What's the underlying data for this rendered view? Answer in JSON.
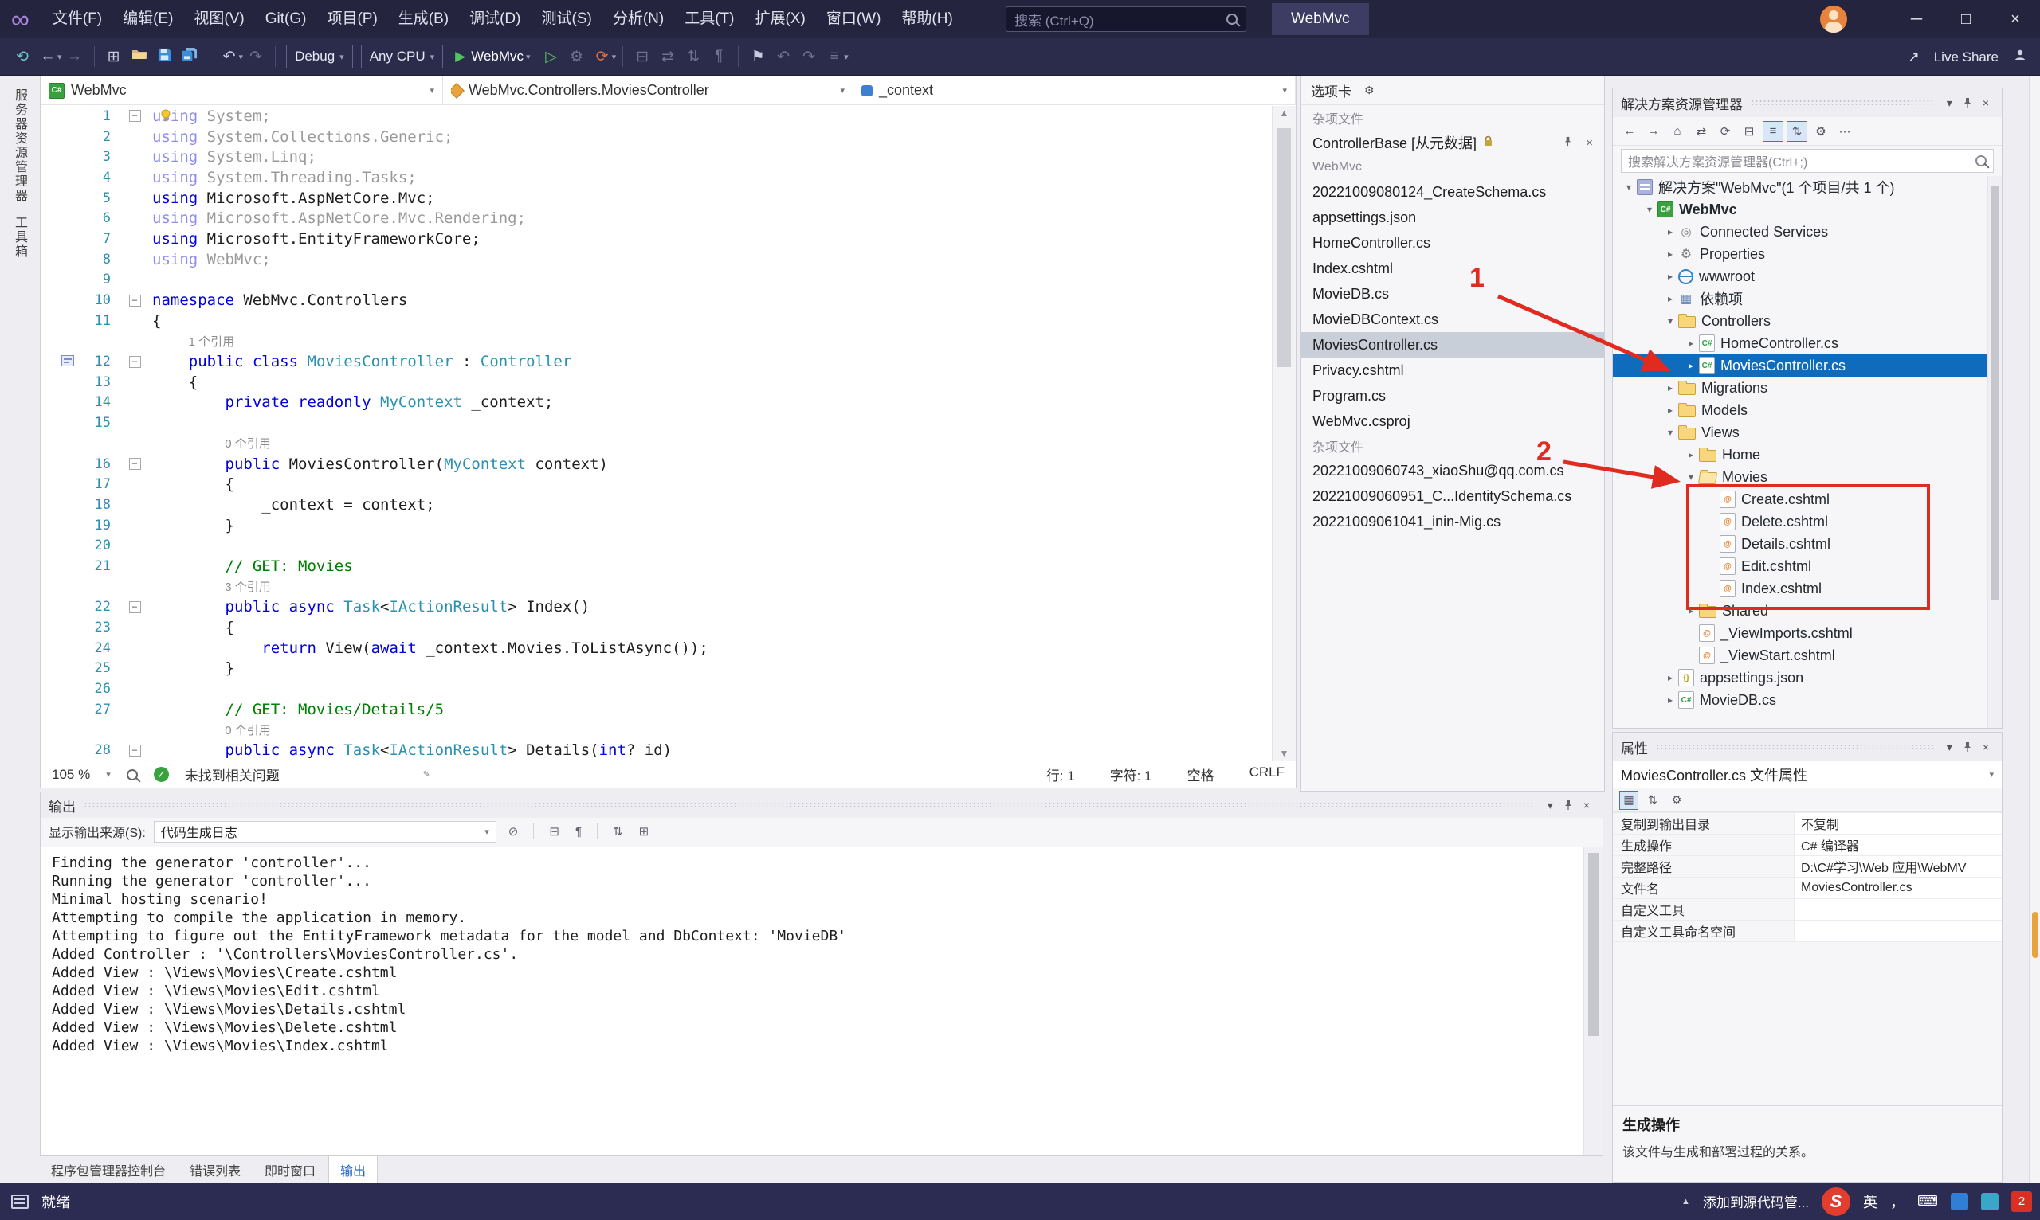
{
  "icons": {
    "minimize": "─",
    "maximize": "□",
    "close": "×",
    "caret": "▾",
    "chevron": "▸",
    "back": "←",
    "forward": "→",
    "nav-circle": "⟲",
    "undo": "↶",
    "redo": "↷",
    "refresh": "⟳",
    "play": "▶",
    "play-outline": "▷",
    "home": "⌂",
    "collapse": "⊟",
    "expand": "⊞",
    "menu": "≡",
    "swap": "⇄",
    "sort": "⇅",
    "bookmark": "⚑",
    "more": "⋯",
    "gear": "⚙",
    "check": "✓",
    "up": "▲",
    "down": "▼",
    "keyboard": "⌨",
    "pencil": "✎",
    "clear": "⊘",
    "wrap": "¶",
    "share": "↗",
    "infinity": "∞",
    "comma": "，",
    "grid": "▦"
  },
  "window": {
    "title": "WebMvc",
    "search_placeholder": "搜索 (Ctrl+Q)"
  },
  "menus": [
    "文件(F)",
    "编辑(E)",
    "视图(V)",
    "Git(G)",
    "项目(P)",
    "生成(B)",
    "调试(D)",
    "测试(S)",
    "分析(N)",
    "工具(T)",
    "扩展(X)",
    "窗口(W)",
    "帮助(H)"
  ],
  "toolbar": {
    "debug": "Debug",
    "platform": "Any CPU",
    "run_target": "WebMvc",
    "live_share": "Live Share"
  },
  "left_tabs": [
    "服务器资源管理器",
    "工具箱"
  ],
  "breadcrumb": {
    "project": "WebMvc",
    "type": "WebMvc.Controllers.MoviesController",
    "member": "_context"
  },
  "editor": {
    "zoom": "105 %",
    "problems": "未找到相关问题",
    "line": "行: 1",
    "col": "字符: 1",
    "space": "空格",
    "eol": "CRLF",
    "rows": [
      {
        "n": "1",
        "fold": true,
        "f": true,
        "s": [
          [
            "kw",
            "using"
          ],
          [
            "pl",
            " System;"
          ]
        ]
      },
      {
        "n": "2",
        "f": true,
        "s": [
          [
            "kw",
            "using"
          ],
          [
            "pl",
            " System.Collections.Generic;"
          ]
        ]
      },
      {
        "n": "3",
        "f": true,
        "s": [
          [
            "kw",
            "using"
          ],
          [
            "pl",
            " System.Linq;"
          ]
        ]
      },
      {
        "n": "4",
        "f": true,
        "s": [
          [
            "kw",
            "using"
          ],
          [
            "pl",
            " System.Threading.Tasks;"
          ]
        ]
      },
      {
        "n": "5",
        "s": [
          [
            "kw",
            "using"
          ],
          [
            "pl",
            " Microsoft.AspNetCore.Mvc;"
          ]
        ]
      },
      {
        "n": "6",
        "f": true,
        "s": [
          [
            "kw",
            "using"
          ],
          [
            "pl",
            " Microsoft.AspNetCore.Mvc.Rendering;"
          ]
        ]
      },
      {
        "n": "7",
        "s": [
          [
            "kw",
            "using"
          ],
          [
            "pl",
            " Microsoft.EntityFrameworkCore;"
          ]
        ]
      },
      {
        "n": "8",
        "f": true,
        "s": [
          [
            "kw",
            "using"
          ],
          [
            "pl",
            " WebMvc;"
          ]
        ]
      },
      {
        "n": "9",
        "s": []
      },
      {
        "n": "10",
        "fold": true,
        "s": [
          [
            "kw",
            "namespace"
          ],
          [
            "pl",
            " WebMvc.Controllers"
          ]
        ]
      },
      {
        "n": "11",
        "s": [
          [
            "pl",
            "{"
          ]
        ]
      },
      {
        "lens": "1 个引用",
        "ind": 4
      },
      {
        "n": "12",
        "fold": true,
        "s": [
          [
            "pl",
            "    "
          ],
          [
            "kw",
            "public"
          ],
          [
            "pl",
            " "
          ],
          [
            "kw",
            "class"
          ],
          [
            "pl",
            " "
          ],
          [
            "ty",
            "MoviesController"
          ],
          [
            "pl",
            " : "
          ],
          [
            "ty",
            "Controller"
          ]
        ]
      },
      {
        "n": "13",
        "s": [
          [
            "pl",
            "    {"
          ]
        ]
      },
      {
        "n": "14",
        "s": [
          [
            "pl",
            "        "
          ],
          [
            "kw",
            "private"
          ],
          [
            "pl",
            " "
          ],
          [
            "kw",
            "readonly"
          ],
          [
            "pl",
            " "
          ],
          [
            "ty",
            "MyContext"
          ],
          [
            "pl",
            " _context;"
          ]
        ]
      },
      {
        "n": "15",
        "s": []
      },
      {
        "lens": "0 个引用",
        "ind": 8
      },
      {
        "n": "16",
        "fold": true,
        "s": [
          [
            "pl",
            "        "
          ],
          [
            "kw",
            "public"
          ],
          [
            "pl",
            " MoviesController("
          ],
          [
            "ty",
            "MyContext"
          ],
          [
            "pl",
            " context)"
          ]
        ]
      },
      {
        "n": "17",
        "s": [
          [
            "pl",
            "        {"
          ]
        ]
      },
      {
        "n": "18",
        "s": [
          [
            "pl",
            "            _context = context;"
          ]
        ]
      },
      {
        "n": "19",
        "s": [
          [
            "pl",
            "        }"
          ]
        ]
      },
      {
        "n": "20",
        "s": []
      },
      {
        "n": "21",
        "s": [
          [
            "pl",
            "        "
          ],
          [
            "cm",
            "// GET: Movies"
          ]
        ]
      },
      {
        "lens": "3 个引用",
        "ind": 8
      },
      {
        "n": "22",
        "fold": true,
        "s": [
          [
            "pl",
            "        "
          ],
          [
            "kw",
            "public"
          ],
          [
            "pl",
            " "
          ],
          [
            "kw",
            "async"
          ],
          [
            "pl",
            " "
          ],
          [
            "ty",
            "Task"
          ],
          [
            "pl",
            "<"
          ],
          [
            "ty",
            "IActionResult"
          ],
          [
            "pl",
            "> Index()"
          ]
        ]
      },
      {
        "n": "23",
        "s": [
          [
            "pl",
            "        {"
          ]
        ]
      },
      {
        "n": "24",
        "s": [
          [
            "pl",
            "            "
          ],
          [
            "kw",
            "return"
          ],
          [
            "pl",
            " View("
          ],
          [
            "kw",
            "await"
          ],
          [
            "pl",
            " _context.Movies.ToListAsync());"
          ]
        ]
      },
      {
        "n": "25",
        "s": [
          [
            "pl",
            "        }"
          ]
        ]
      },
      {
        "n": "26",
        "s": []
      },
      {
        "n": "27",
        "s": [
          [
            "pl",
            "        "
          ],
          [
            "cm",
            "// GET: Movies/Details/5"
          ]
        ]
      },
      {
        "lens": "0 个引用",
        "ind": 8
      },
      {
        "n": "28",
        "fold": true,
        "s": [
          [
            "pl",
            "        "
          ],
          [
            "kw",
            "public"
          ],
          [
            "pl",
            " "
          ],
          [
            "kw",
            "async"
          ],
          [
            "pl",
            " "
          ],
          [
            "ty",
            "Task"
          ],
          [
            "pl",
            "<"
          ],
          [
            "ty",
            "IActionResult"
          ],
          [
            "pl",
            "> Details("
          ],
          [
            "kw",
            "int"
          ],
          [
            "pl",
            "? id)"
          ]
        ]
      }
    ]
  },
  "tabs_panel": {
    "title": "选项卡",
    "sections": [
      {
        "label": "杂项文件",
        "items": [
          {
            "text": "ControllerBase [从元数据]",
            "lock": true,
            "preview": true
          }
        ]
      },
      {
        "label": "WebMvc",
        "items": [
          {
            "text": "20221009080124_CreateSchema.cs"
          },
          {
            "text": "appsettings.json"
          },
          {
            "text": "HomeController.cs"
          },
          {
            "text": "Index.cshtml"
          },
          {
            "text": "MovieDB.cs"
          },
          {
            "text": "MovieDBContext.cs"
          },
          {
            "text": "MoviesController.cs",
            "sel": true
          },
          {
            "text": "Privacy.cshtml"
          },
          {
            "text": "Program.cs"
          },
          {
            "text": "WebMvc.csproj"
          }
        ]
      },
      {
        "label": "杂项文件",
        "items": [
          {
            "text": "20221009060743_xiaoShu@qq.com.cs"
          },
          {
            "text": "20221009060951_C...IdentitySchema.cs"
          },
          {
            "text": "20221009061041_inin-Mig.cs"
          }
        ]
      }
    ]
  },
  "solution_explorer": {
    "title": "解决方案资源管理器",
    "search_placeholder": "搜索解决方案资源管理器(Ctrl+;)",
    "tree": [
      {
        "l": "解决方案\"WebMvc\"(1 个项目/共 1 个)",
        "i": 0,
        "a": "e",
        "ic": "sol"
      },
      {
        "l": "WebMvc",
        "i": 1,
        "a": "e",
        "ic": "csproj",
        "b": true
      },
      {
        "l": "Connected Services",
        "i": 2,
        "a": "c",
        "ic": "svc"
      },
      {
        "l": "Properties",
        "i": 2,
        "a": "c",
        "ic": "props"
      },
      {
        "l": "wwwroot",
        "i": 2,
        "a": "c",
        "ic": "globe"
      },
      {
        "l": "依赖项",
        "i": 2,
        "a": "c",
        "ic": "deps"
      },
      {
        "l": "Controllers",
        "i": 2,
        "a": "e",
        "ic": "folder"
      },
      {
        "l": "HomeController.cs",
        "i": 3,
        "a": "c",
        "ic": "cs"
      },
      {
        "l": "MoviesController.cs",
        "i": 3,
        "a": "c",
        "ic": "cs",
        "sel": true
      },
      {
        "l": "Migrations",
        "i": 2,
        "a": "c",
        "ic": "folder"
      },
      {
        "l": "Models",
        "i": 2,
        "a": "c",
        "ic": "folder"
      },
      {
        "l": "Views",
        "i": 2,
        "a": "e",
        "ic": "folder"
      },
      {
        "l": "Home",
        "i": 3,
        "a": "c",
        "ic": "folder"
      },
      {
        "l": "Movies",
        "i": 3,
        "a": "e",
        "ic": "folderopen"
      },
      {
        "l": "Create.cshtml",
        "i": 4,
        "ic": "razor"
      },
      {
        "l": "Delete.cshtml",
        "i": 4,
        "ic": "razor"
      },
      {
        "l": "Details.cshtml",
        "i": 4,
        "ic": "razor"
      },
      {
        "l": "Edit.cshtml",
        "i": 4,
        "ic": "razor"
      },
      {
        "l": "Index.cshtml",
        "i": 4,
        "ic": "razor"
      },
      {
        "l": "Shared",
        "i": 3,
        "a": "c",
        "ic": "folder"
      },
      {
        "l": "_ViewImports.cshtml",
        "i": 3,
        "ic": "razor"
      },
      {
        "l": "_ViewStart.cshtml",
        "i": 3,
        "ic": "razor"
      },
      {
        "l": "appsettings.json",
        "i": 2,
        "a": "c",
        "ic": "json"
      },
      {
        "l": "MovieDB.cs",
        "i": 2,
        "a": "c",
        "ic": "cs"
      }
    ]
  },
  "properties": {
    "title": "属性",
    "subtitle": "MoviesController.cs 文件属性",
    "rows": [
      [
        "复制到输出目录",
        "不复制"
      ],
      [
        "生成操作",
        "C# 编译器"
      ],
      [
        "完整路径",
        "D:\\C#学习\\Web 应用\\WebMV"
      ],
      [
        "文件名",
        "MoviesController.cs"
      ],
      [
        "自定义工具",
        ""
      ],
      [
        "自定义工具命名空间",
        ""
      ]
    ],
    "desc_title": "生成操作",
    "desc_text": "该文件与生成和部署过程的关系。"
  },
  "output": {
    "title": "输出",
    "source_label": "显示输出来源(S):",
    "source_value": "代码生成日志",
    "lines": [
      "Finding the generator 'controller'...",
      "Running the generator 'controller'...",
      "Minimal hosting scenario!",
      "Attempting to compile the application in memory.",
      "Attempting to figure out the EntityFramework metadata for the model and DbContext: 'MovieDB'",
      "Added Controller : '\\Controllers\\MoviesController.cs'.",
      "Added View : \\Views\\Movies\\Create.cshtml",
      "Added View : \\Views\\Movies\\Edit.cshtml",
      "Added View : \\Views\\Movies\\Details.cshtml",
      "Added View : \\Views\\Movies\\Delete.cshtml",
      "Added View : \\Views\\Movies\\Index.cshtml"
    ],
    "tabs": [
      "程序包管理器控制台",
      "错误列表",
      "即时窗口",
      "输出"
    ],
    "active_tab": "输出"
  },
  "status_bar": {
    "ready": "就绪",
    "scm": "添加到源代码管...",
    "logo": "S",
    "ime": "英",
    "badge": "2"
  },
  "annotations": {
    "label1": "1",
    "label2": "2"
  }
}
